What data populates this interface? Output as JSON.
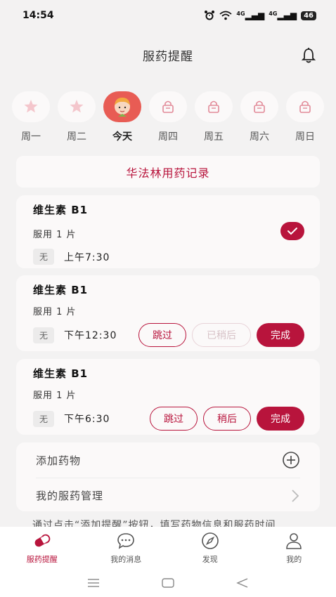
{
  "status_bar": {
    "time": "14:54",
    "network1": "4G",
    "network2": "4G",
    "battery": "46"
  },
  "header": {
    "title": "服药提醒",
    "bell_icon": "bell-icon"
  },
  "week": [
    {
      "label": "周一",
      "state": "done",
      "icon": "star-icon"
    },
    {
      "label": "周二",
      "state": "done",
      "icon": "star-icon"
    },
    {
      "label": "今天",
      "state": "today",
      "icon": "avatar-icon"
    },
    {
      "label": "周四",
      "state": "locked",
      "icon": "lock-icon"
    },
    {
      "label": "周五",
      "state": "locked",
      "icon": "lock-icon"
    },
    {
      "label": "周六",
      "state": "locked",
      "icon": "lock-icon"
    },
    {
      "label": "周日",
      "state": "locked",
      "icon": "lock-icon"
    }
  ],
  "record": {
    "label": "华法林用药记录"
  },
  "medications": [
    {
      "name": "维生素 B1",
      "dose": "服用 1 片",
      "tag": "无",
      "time": "上午7:30",
      "status": "done"
    },
    {
      "name": "维生素 B1",
      "dose": "服用 1 片",
      "tag": "无",
      "time": "下午12:30",
      "buttons": {
        "skip": "跳过",
        "later": "已稍后",
        "done": "完成"
      }
    },
    {
      "name": "维生素 B1",
      "dose": "服用 1 片",
      "tag": "无",
      "time": "下午6:30",
      "buttons": {
        "skip": "跳过",
        "later": "稍后",
        "done": "完成"
      }
    }
  ],
  "manage": {
    "add_label": "添加药物",
    "my_label": "我的服药管理"
  },
  "hint": "通过点击“添加提醒”按钮，填写药物信息和服药时间",
  "tabs": [
    {
      "label": "服药提醒",
      "icon": "pill-icon",
      "active": true
    },
    {
      "label": "我的消息",
      "icon": "message-icon",
      "active": false
    },
    {
      "label": "发现",
      "icon": "compass-icon",
      "active": false
    },
    {
      "label": "我的",
      "icon": "profile-icon",
      "active": false
    }
  ],
  "colors": {
    "accent": "#b8143c",
    "background": "#f3f2f2",
    "card": "#fbf9f9"
  }
}
